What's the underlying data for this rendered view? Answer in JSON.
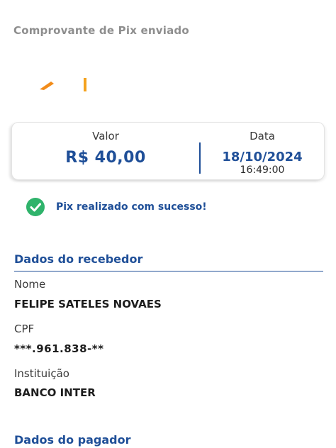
{
  "header": {
    "title": "Comprovante de Pix enviado"
  },
  "logo": {
    "icon": "bank-logo-icon",
    "color": "#f28c1a"
  },
  "summary": {
    "valor_label": "Valor",
    "valor_amount": "R$ 40,00",
    "data_label": "Data",
    "data_date": "18/10/2024",
    "data_time": "16:49:00"
  },
  "status": {
    "icon": "check-circle-icon",
    "text": "Pix realizado com sucesso!",
    "color": "#2fb36b"
  },
  "receiver": {
    "section_title": "Dados do recebedor",
    "nome_label": "Nome",
    "nome_value": "FELIPE SATELES NOVAES",
    "cpf_label": "CPF",
    "cpf_value": "***.961.838-**",
    "instituicao_label": "Instituição",
    "instituicao_value": "BANCO INTER"
  },
  "payer": {
    "section_title": "Dados do pagador"
  },
  "colors": {
    "accent": "#1f4f98",
    "muted_title": "#8e8e8e"
  }
}
